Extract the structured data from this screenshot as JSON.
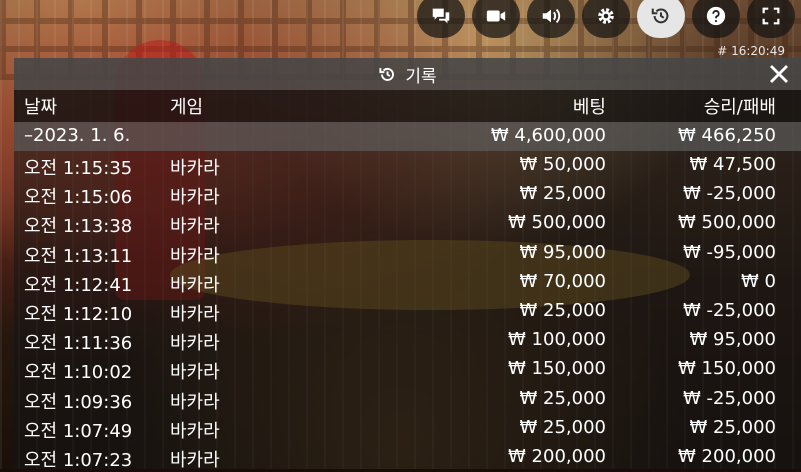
{
  "toolbar": {
    "buttons": [
      {
        "icon": "chat-icon"
      },
      {
        "icon": "video-icon"
      },
      {
        "icon": "volume-icon"
      },
      {
        "icon": "gear-icon"
      },
      {
        "icon": "history-icon",
        "active": true
      },
      {
        "icon": "help-icon"
      },
      {
        "icon": "fullscreen-icon"
      }
    ],
    "time": "# 16:20:49"
  },
  "panel": {
    "title": "기록",
    "columns": {
      "date": "날짜",
      "game": "게임",
      "bet": "베팅",
      "result": "승리/패배"
    },
    "summary": {
      "date": "–2023. 1. 6.",
      "bet": "₩ 4,600,000",
      "result": "₩ 466,250"
    },
    "rows": [
      {
        "time": "오전 1:15:35",
        "game": "바카라",
        "bet": "₩ 50,000",
        "result": "₩ 47,500"
      },
      {
        "time": "오전 1:15:06",
        "game": "바카라",
        "bet": "₩ 25,000",
        "result": "₩ -25,000"
      },
      {
        "time": "오전 1:13:38",
        "game": "바카라",
        "bet": "₩ 500,000",
        "result": "₩ 500,000"
      },
      {
        "time": "오전 1:13:11",
        "game": "바카라",
        "bet": "₩ 95,000",
        "result": "₩ -95,000"
      },
      {
        "time": "오전 1:12:41",
        "game": "바카라",
        "bet": "₩ 70,000",
        "result": "₩ 0"
      },
      {
        "time": "오전 1:12:10",
        "game": "바카라",
        "bet": "₩ 25,000",
        "result": "₩ -25,000"
      },
      {
        "time": "오전 1:11:36",
        "game": "바카라",
        "bet": "₩ 100,000",
        "result": "₩ 95,000"
      },
      {
        "time": "오전 1:10:02",
        "game": "바카라",
        "bet": "₩ 150,000",
        "result": "₩ 150,000"
      },
      {
        "time": "오전 1:09:36",
        "game": "바카라",
        "bet": "₩ 25,000",
        "result": "₩ -25,000"
      },
      {
        "time": "오전 1:07:49",
        "game": "바카라",
        "bet": "₩ 25,000",
        "result": "₩ 25,000"
      },
      {
        "time": "오전 1:07:23",
        "game": "바카라",
        "bet": "₩ 200,000",
        "result": "₩ 200,000"
      }
    ]
  }
}
